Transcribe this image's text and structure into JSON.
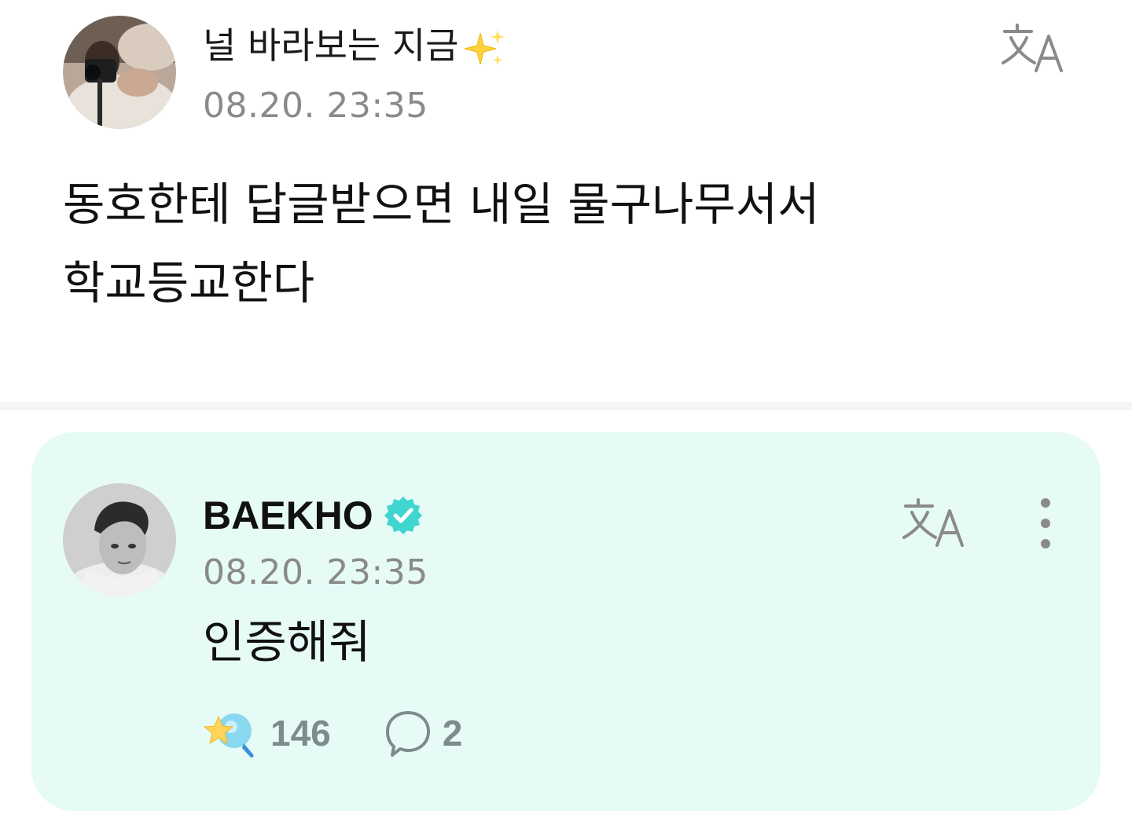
{
  "fan_post": {
    "author_name": "널 바라보는 지금",
    "author_emoji_icon": "sparkles-icon",
    "timestamp": "08.20. 23:35",
    "translate_icon": "translate-icon",
    "body_lines": [
      "동호한테 답글받으면 내일 물구나무서서",
      "학교등교한다"
    ]
  },
  "artist_reply": {
    "author_name": "BAEKHO",
    "verified_icon": "verified-badge-icon",
    "timestamp": "08.20. 23:35",
    "translate_icon": "translate-icon",
    "more_icon": "more-vertical-icon",
    "body": "인증해줘",
    "like_count": "146",
    "comment_count": "2"
  },
  "colors": {
    "reply_background": "#e6fbf6",
    "verified": "#3fd6d0",
    "secondary_text": "#8a8a8a",
    "reaction_text": "#7d8c8a"
  }
}
